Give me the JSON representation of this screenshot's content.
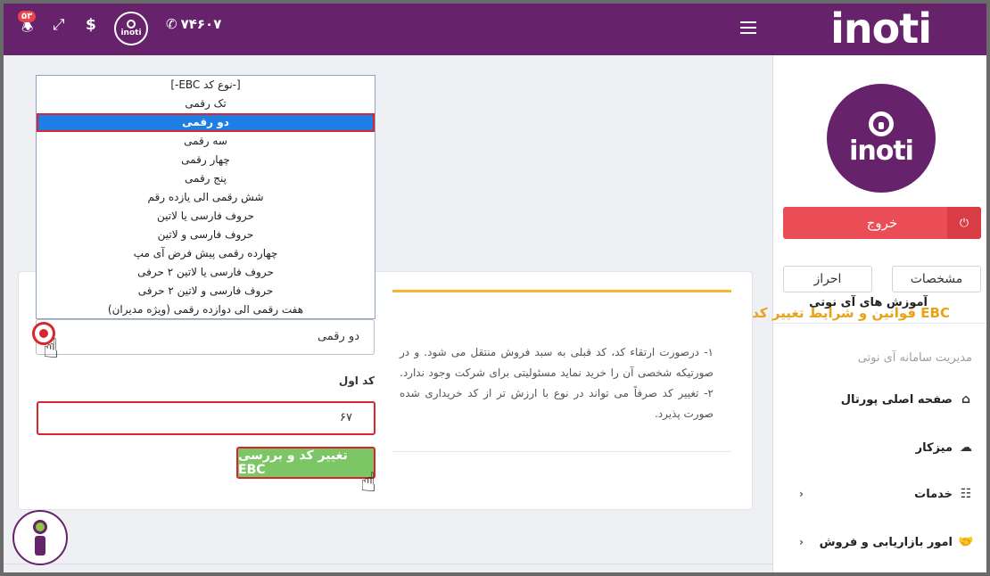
{
  "header": {
    "brand": "inoti",
    "phone": "۷۴۶۰۷",
    "logo_text": "inoti",
    "notification_count": "۵۳",
    "accent_color": "#66226a"
  },
  "sidebar": {
    "avatar_text": "inoti",
    "logout_label": "خروج",
    "specs_label": "مشخصات",
    "verify_label": "احراز",
    "tutorial_label": "آموزش های آی نوتی",
    "section_title": "مدیریت سامانه آی نوتی",
    "items": [
      {
        "label": "صفحه اصلی پورتال",
        "icon": "home-icon"
      },
      {
        "label": "میزکار",
        "icon": "cloud-icon"
      },
      {
        "label": "خدمات",
        "icon": "sliders-icon"
      },
      {
        "label": "امور بازاریابی و فروش",
        "icon": "handshake-icon"
      }
    ]
  },
  "rules": {
    "title": "قوانین و شرایط تغییر کد EBC",
    "text": "۱- درصورت ارتقاء کد، کد قبلی به سبد فروش منتقل می شود. و در صورتیکه شخصی آن را خرید نماید مسئولیتی برای شرکت وجود ندارد. ۲- تغییر کد صرفاً می تواند در نوع با ارزش تر از کد خریداری شده صورت پذیرد."
  },
  "form": {
    "select_value": "دو رقمی",
    "field_label": "کد اول",
    "input_value": "۶۷",
    "submit_label": "تغییر کد و بررسی EBC"
  },
  "dropdown": {
    "options": [
      "[-نوع کد EBC-]",
      "تک رقمی",
      "دو رقمی",
      "سه رقمی",
      "چهار رقمی",
      "پنج رقمی",
      "شش رقمی الی یازده رقم",
      "حروف فارسی یا لاتین",
      "حروف فارسی و لاتین",
      "چهارده رقمی پیش فرض آی مپ",
      "حروف فارسی یا لاتین ۲ حرفی",
      "حروف فارسی و لاتین ۲ حرفی",
      "هفت رقمی الی دوازده رقمی (ویژه مدیران)"
    ],
    "selected_index": 2
  }
}
